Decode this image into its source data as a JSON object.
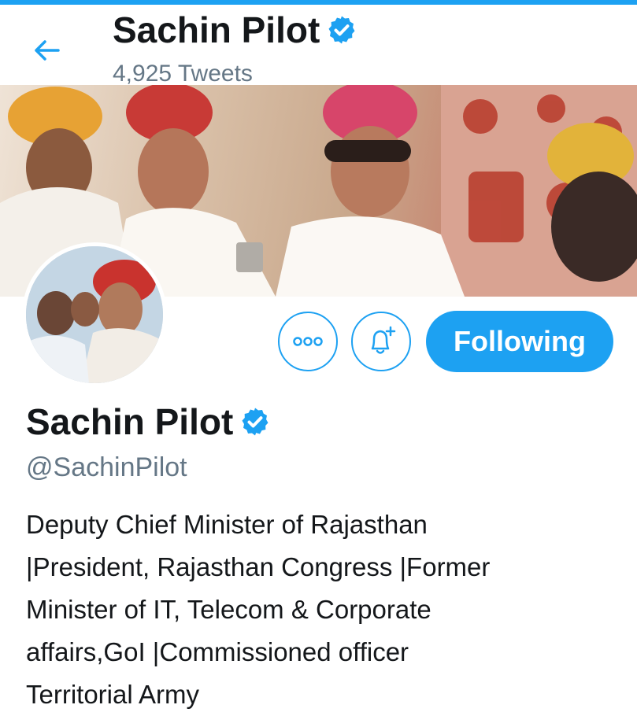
{
  "header": {
    "back_icon": "arrow-left-icon",
    "title": "Sachin Pilot",
    "tweet_count": "4,925 Tweets"
  },
  "profile": {
    "name": "Sachin Pilot",
    "verified_icon": "verified-badge-icon",
    "handle": "@SachinPilot",
    "bio_lines": [
      "Deputy Chief Minister of Rajasthan",
      "|President, Rajasthan Congress |Former",
      "Minister of IT, Telecom & Corporate",
      "affairs,GoI |Commissioned officer",
      "Territorial Army"
    ]
  },
  "actions": {
    "more_icon": "more-options-icon",
    "notify_icon": "bell-plus-icon",
    "follow_label": "Following"
  },
  "colors": {
    "accent": "#1da1f2",
    "text_primary": "#14171a",
    "text_secondary": "#657786"
  }
}
